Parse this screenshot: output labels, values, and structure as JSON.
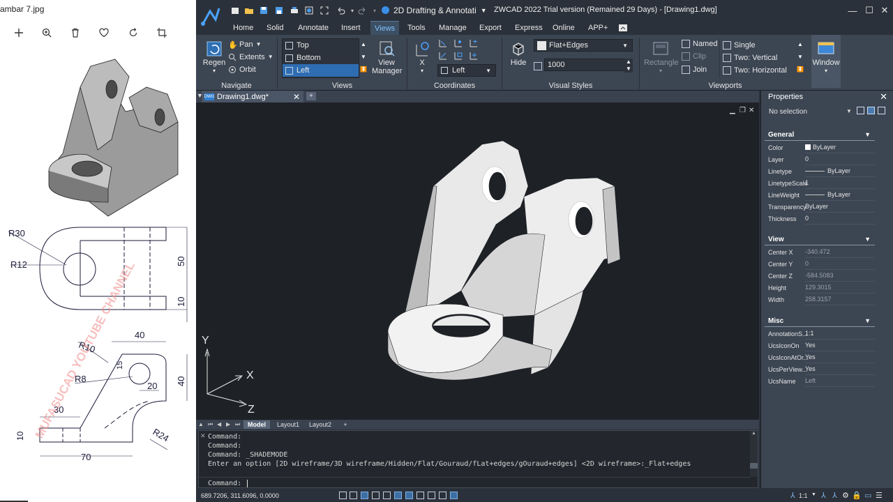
{
  "viewer": {
    "file_title": "ambar 7.jpg",
    "tools": [
      "add-icon",
      "zoom-in-icon",
      "delete-icon",
      "heart-icon",
      "rotate-icon",
      "crop-icon"
    ],
    "drawing": {
      "labels": {
        "r30": "R30",
        "r12": "R12",
        "dim50": "50",
        "dim10_top": "10",
        "dim40_top": "40",
        "r10": "R10",
        "dim15": "15",
        "r8": "R8",
        "dim20": "20",
        "dim40_side": "40",
        "dim30": "30",
        "dim10_left": "10",
        "r24": "R24",
        "dim70": "70"
      },
      "watermark": "MUFASUCAD YOUTUBE CHANNEL"
    }
  },
  "cad": {
    "workspace": "2D Drafting & Annotati",
    "window_title": "ZWCAD 2022 Trial version (Remained 29 Days) - [Drawing1.dwg]",
    "menu": [
      "Home",
      "Solid",
      "Annotate",
      "Insert",
      "Views",
      "Tools",
      "Manage",
      "Export",
      "Express",
      "Online",
      "APP+"
    ],
    "active_menu": "Views",
    "ribbon": {
      "navigate": {
        "label": "Navigate",
        "regen": "Regen",
        "pan": "Pan",
        "extents": "Extents",
        "orbit": "Orbit"
      },
      "views": {
        "label": "Views",
        "list": [
          "Top",
          "Bottom",
          "Left"
        ],
        "selected": "Left",
        "view_manager": "View Manager"
      },
      "coordinates": {
        "label": "Coordinates",
        "x": "X",
        "ucs_view": "Left"
      },
      "visual_styles": {
        "label": "Visual Styles",
        "hide": "Hide",
        "style": "Flat+Edges",
        "value": "1000"
      },
      "viewports": {
        "label": "Viewports",
        "rectangle": "Rectangle",
        "named": "Named",
        "clip": "Clip",
        "join": "Join",
        "single": "Single",
        "two_vertical": "Two:   Vertical",
        "two_horizontal": "Two:   Horizontal",
        "window": "Window"
      }
    },
    "doc_tab": "Drawing1.dwg*",
    "axes": {
      "y": "Y",
      "x": "X",
      "z": "Z"
    },
    "layout_tabs": [
      "Model",
      "Layout1",
      "Layout2",
      "+"
    ],
    "command_history": [
      "Command:",
      "Command:",
      "Command: _SHADEMODE",
      "Enter an option [2D wireframe/3D wireframe/Hidden/Flat/Gouraud/fLat+edges/gOuraud+edges] <2D wireframe>:_Flat+edges"
    ],
    "command_prompt": "Command:",
    "properties": {
      "title": "Properties",
      "selection": "No selection",
      "general": {
        "label": "General",
        "rows": [
          {
            "key": "Color",
            "value": "ByLayer"
          },
          {
            "key": "Layer",
            "value": "0"
          },
          {
            "key": "Linetype",
            "value": "ByLayer"
          },
          {
            "key": "LinetypeScale",
            "value": "1"
          },
          {
            "key": "LineWeight",
            "value": "ByLayer"
          },
          {
            "key": "Transparency",
            "value": "ByLayer"
          },
          {
            "key": "Thickness",
            "value": "0"
          }
        ]
      },
      "view": {
        "label": "View",
        "rows": [
          {
            "key": "Center X",
            "value": "-340.472"
          },
          {
            "key": "Center Y",
            "value": "0"
          },
          {
            "key": "Center Z",
            "value": "-584.5083"
          },
          {
            "key": "Height",
            "value": "129.3015"
          },
          {
            "key": "Width",
            "value": "258.3157"
          }
        ]
      },
      "misc": {
        "label": "Misc",
        "rows": [
          {
            "key": "AnnotationS...",
            "value": "1:1"
          },
          {
            "key": "UcsIconOn",
            "value": "Yes"
          },
          {
            "key": "UcsIconAtOr...",
            "value": "Yes"
          },
          {
            "key": "UcsPerView...",
            "value": "Yes"
          },
          {
            "key": "UcsName",
            "value": "Left"
          }
        ]
      }
    },
    "status": {
      "coords": "689.7206, 311.6096, 0.0000",
      "scale": "1:1"
    }
  }
}
